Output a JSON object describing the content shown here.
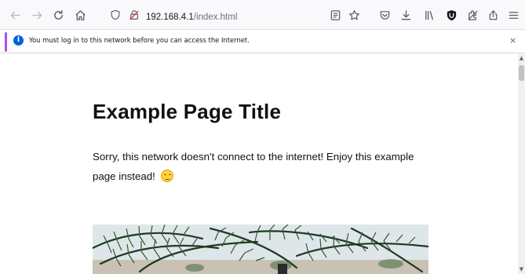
{
  "browser": {
    "url_host": "192.168.4.1",
    "url_path": "/index.html"
  },
  "notification": {
    "message": "You must log in to this network before you can access the Internet.",
    "close_glyph": "×"
  },
  "page": {
    "title": "Example Page Title",
    "paragraph": "Sorry, this network doesn't connect to the internet! Enjoy this example page instead!"
  },
  "icons": {
    "back": "back-arrow-icon",
    "forward": "forward-arrow-icon",
    "reload": "reload-icon",
    "home": "home-icon",
    "tracking": "tracking-protection-shield-icon",
    "security": "insecure-connection-icon",
    "reader": "reader-view-icon",
    "bookmark": "bookmark-star-icon",
    "pocket": "pocket-icon",
    "downloads": "downloads-icon",
    "library": "library-icon",
    "extension": "ublock-extension-icon",
    "extensions": "extensions-puzzle-icon",
    "share": "share-icon",
    "menu": "hamburger-menu-icon",
    "info": "info-icon",
    "emoji": "smiling-face-emoji"
  },
  "colors": {
    "notification_accent": "#9059ff",
    "info": "#0060df"
  }
}
